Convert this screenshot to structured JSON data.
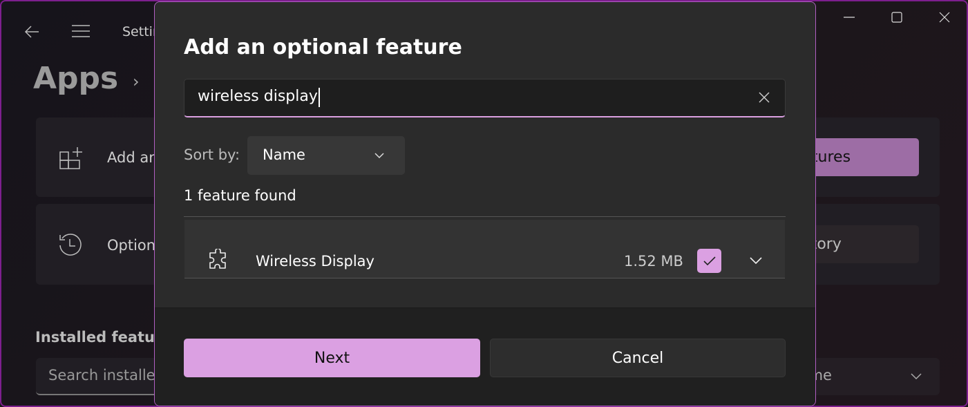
{
  "window": {
    "title": "Settings",
    "controls": {
      "minimize": "minimize-icon",
      "maximize": "maximize-icon",
      "close": "close-icon"
    }
  },
  "background": {
    "page_title": "Apps",
    "add_card_label": "Add an optional feature",
    "view_features_button": "View features",
    "history_card_label": "Optional features history",
    "see_history_button": "See history",
    "installed_heading": "Installed features",
    "search_placeholder": "Search installed features",
    "sort_value": "Name"
  },
  "dialog": {
    "title": "Add an optional feature",
    "search_value": "wireless display",
    "sort_label": "Sort by:",
    "sort_value": "Name",
    "result_count": "1 feature found",
    "features": [
      {
        "name": "Wireless Display",
        "size": "1.52 MB",
        "checked": true
      }
    ],
    "next_button": "Next",
    "cancel_button": "Cancel"
  },
  "colors": {
    "accent": "#dba0e2",
    "window_border": "#7d1f8e"
  }
}
